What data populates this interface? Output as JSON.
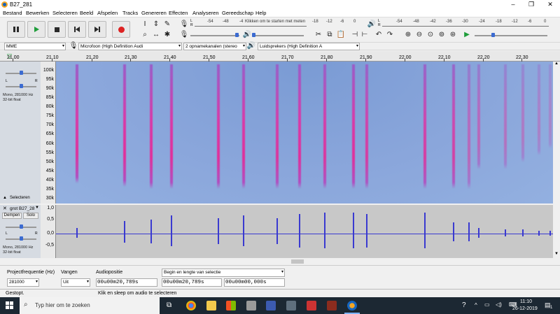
{
  "window": {
    "title": "B27_281",
    "min_glyph": "–",
    "max_glyph": "❐",
    "close_glyph": "✕"
  },
  "menu": [
    "Bestand",
    "Bewerken",
    "Selecteren",
    "Beeld",
    "Afspelen",
    "Tracks",
    "Genereren",
    "Effecten",
    "Analyseren",
    "Gereedschap",
    "Help"
  ],
  "toolbar": {
    "record_meter_ticks": [
      "-54",
      "-48",
      "-4"
    ],
    "record_meter_hint": "Klikken om te starten met meten",
    "record_meter_ticks2": [
      "-18",
      "-12",
      "-6",
      "0"
    ],
    "play_meter_ticks": [
      "-54",
      "-48",
      "-42",
      "-36",
      "-30",
      "-24",
      "-18",
      "-12",
      "-6",
      "0"
    ],
    "meter_l": "L",
    "meter_r": "R"
  },
  "device": {
    "host": "MME",
    "input": "Microfoon (High Definition Audi",
    "channels": "2 opnamekanalen (stereo",
    "output": "Luidsprekers (High Definition A"
  },
  "ruler": [
    "21,00",
    "21,10",
    "21,20",
    "21,30",
    "21,40",
    "21,50",
    "21,60",
    "21,70",
    "21,80",
    "21,90",
    "22,00",
    "22,10",
    "22,20",
    "22,30"
  ],
  "spectrogram_track": {
    "collapse_glyph": "▲",
    "select_label": "Selecteren",
    "info": [
      "Mono, 281000 Hz",
      "32-bit float"
    ],
    "gain_l": "L",
    "gain_r": "R",
    "scale": [
      "100k",
      "95k",
      "90k",
      "85k",
      "80k",
      "75k",
      "70k",
      "65k",
      "60k",
      "55k",
      "50k",
      "45k",
      "40k",
      "35k",
      "30k"
    ]
  },
  "wave_track": {
    "close_glyph": "✕",
    "name": "grot B27_28",
    "mute": "Dempen",
    "solo": "Solo",
    "gain_l": "L",
    "gain_r": "R",
    "info": [
      "Mono, 281000 Hz",
      "32-bit float"
    ],
    "scale": [
      "1,0",
      "0,5",
      "0,0",
      "-0,5",
      "-1,0"
    ]
  },
  "selection": {
    "rate_label": "Projectfrequentie (Hz)",
    "rate_value": "281000",
    "snap_label": "Vangen",
    "snap_value": "Uit",
    "pos_label": "Audiopositie",
    "pos_value": "00u00m20,789s",
    "sel_mode": "Begin en lengte van selectie",
    "sel_start": "00u00m20,789s",
    "sel_length": "00u00m00,000s"
  },
  "status": {
    "left": "Gestopt.",
    "hint": "Klik en sleep om audio te selecteren"
  },
  "taskbar": {
    "search_placeholder": "Typ hier om te zoeken",
    "time": "11:10",
    "date": "26-12-2019",
    "notif_count": "1"
  }
}
